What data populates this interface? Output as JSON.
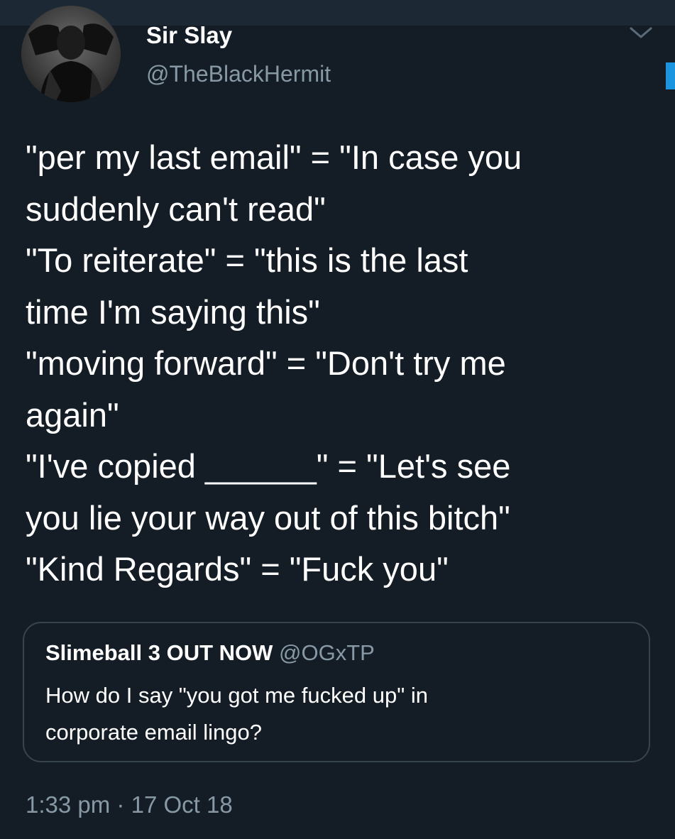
{
  "author": {
    "display_name": "Sir Slay",
    "handle": "@TheBlackHermit"
  },
  "tweet": {
    "lines": [
      "\"per my last email\" = \"In case you",
      "suddenly can't read\"",
      "\"To reiterate\" = \"this is the last",
      "time I'm saying this\"",
      "\"moving forward\" = \"Don't try me",
      "again\"",
      "\"I've copied ______\" = \"Let's see",
      "you lie your way out of this bitch\"",
      "\"Kind Regards\" = \"Fuck you\""
    ]
  },
  "quoted_tweet": {
    "author": "Slimeball 3 OUT NOW",
    "handle": "@OGxTP",
    "lines": [
      "How do I say \"you got me fucked up\" in",
      "corporate email lingo?"
    ]
  },
  "meta": {
    "time": "1:33 pm",
    "separator": "·",
    "date": "17 Oct 18"
  },
  "icons": {
    "menu": "chevron-down-icon",
    "avatar": "avatar"
  },
  "colors": {
    "background": "#141d26",
    "secondary_text": "#8899a6",
    "accent": "#1b95e0",
    "border": "#38444d"
  }
}
